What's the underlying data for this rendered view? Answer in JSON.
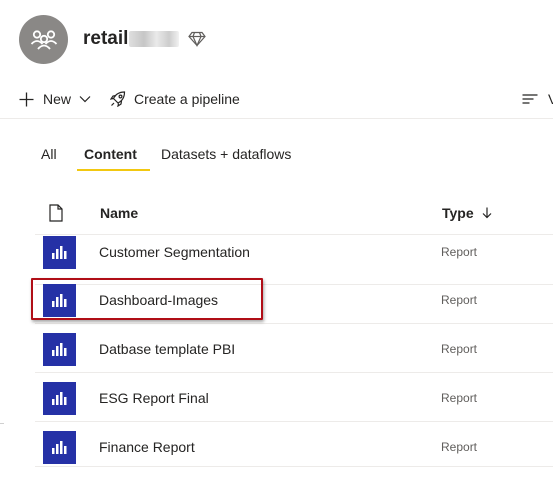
{
  "workspace": {
    "name": "retail",
    "avatar_icon": "people-group-icon",
    "premium_icon": "diamond-icon"
  },
  "toolbar": {
    "new_label": "New",
    "pipeline_label": "Create a pipeline",
    "view_label": "V"
  },
  "tabs": [
    {
      "label": "All"
    },
    {
      "label": "Content",
      "selected": true
    },
    {
      "label": "Datasets + dataflows"
    }
  ],
  "table": {
    "headers": {
      "name": "Name",
      "type": "Type"
    },
    "rows": [
      {
        "name": "Customer Segmentation",
        "type": "Report",
        "icon": "report-icon"
      },
      {
        "name": "Dashboard-Images",
        "type": "Report",
        "icon": "report-icon",
        "highlighted": true
      },
      {
        "name": "Datbase template PBI",
        "type": "Report",
        "icon": "report-icon"
      },
      {
        "name": "ESG Report Final",
        "type": "Report",
        "icon": "report-icon"
      },
      {
        "name": "Finance Report",
        "type": "Report",
        "icon": "report-icon"
      }
    ]
  },
  "colors": {
    "accent_underline": "#f2c811",
    "report_tile": "#2531a6",
    "highlight_border": "#b00e17",
    "avatar_bg": "#8a8886"
  }
}
